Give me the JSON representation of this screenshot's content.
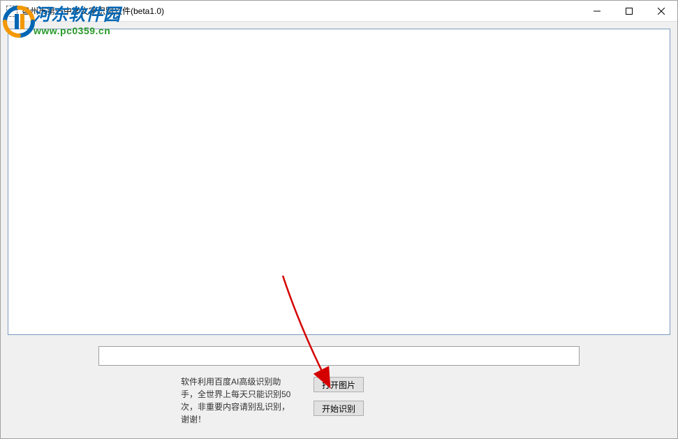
{
  "window": {
    "title": "盘州市第一中学文字识别软件(beta1.0)"
  },
  "textbox": {
    "value": ""
  },
  "notice": {
    "text": "软件利用百度AI高级识别助手，全世界上每天只能识别50次，非重要内容请别乱识别，谢谢！"
  },
  "buttons": {
    "open_image": "打开图片",
    "start_ocr": "开始识别"
  },
  "watermark": {
    "cn": "河东软件园",
    "url": "www.pc0359.cn"
  }
}
